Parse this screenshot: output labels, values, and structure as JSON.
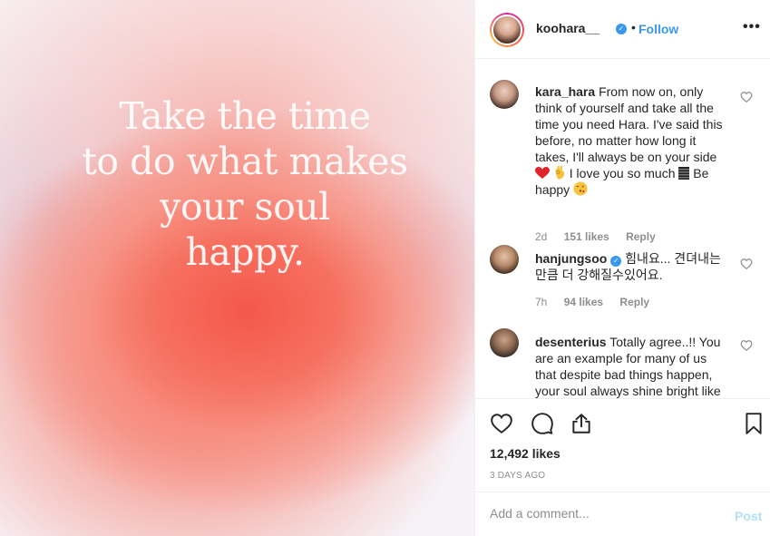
{
  "post": {
    "quote_lines": [
      "Take the time",
      "to do what makes",
      "your soul",
      "happy."
    ]
  },
  "header": {
    "username": "koohara__",
    "verified_icon": "verified-badge-icon",
    "separator": "•",
    "follow_label": "Follow",
    "more_label": "•••"
  },
  "comments": [
    {
      "username": "kara_hara",
      "text_parts": [
        "From now on, only think of yourself and take all the time you need Hara. I've said this before, no matter how long it takes, I'll always be on your side",
        " I love you so much",
        "Be happy"
      ],
      "emojis": [
        "red-heart",
        "ok-hand",
        "black-flag-like",
        "kissing-face"
      ],
      "age": "2d",
      "likes": "151 likes",
      "reply": "Reply"
    },
    {
      "username": "hanjungsoo",
      "verified": true,
      "text": "힘내요... 견뎌내는만큼 더 강해질수있어요.",
      "age": "7h",
      "likes": "94 likes",
      "reply": "Reply"
    },
    {
      "username": "desenterius",
      "text": "Totally agree..!! You are an example for many of us that despite bad things happen, your soul always shine bright like"
    }
  ],
  "actions": {
    "like_icon": "heart-icon",
    "comment_icon": "comment-icon",
    "share_icon": "share-icon",
    "save_icon": "bookmark-icon",
    "likes_count": "12,492 likes",
    "timestamp": "3 DAYS AGO"
  },
  "add_comment": {
    "placeholder": "Add a comment...",
    "post_label": "Post"
  },
  "colors": {
    "accent": "#3897f0",
    "post_disabled": "#b2dffc",
    "muted": "#8e8e8e",
    "text": "#262626"
  }
}
